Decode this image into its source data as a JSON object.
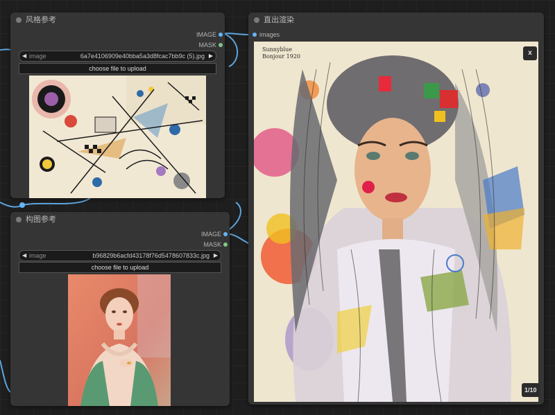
{
  "colors": {
    "canvas": "#1e1e1e",
    "node_bg": "#353535",
    "wire_image": "#64b5f6",
    "mask_socket": "#81c784"
  },
  "node_style": {
    "title": "风格参考",
    "outputs": [
      "IMAGE",
      "MASK"
    ],
    "widget_label": "image",
    "widget_value": "6a7e4106909e40bba5a3d8fcac7bb9c (5).jpg",
    "upload_label": "choose file to upload"
  },
  "node_composition": {
    "title": "构图参考",
    "outputs": [
      "IMAGE",
      "MASK"
    ],
    "widget_label": "image",
    "widget_value": "b96829b6acfd43178f76d5478607833c.jpg",
    "upload_label": "choose file to upload"
  },
  "node_render": {
    "title": "直出渲染",
    "input": "images",
    "close_label": "x",
    "counter": "1/10",
    "artwork_text": [
      "Sunnyblue",
      "Bonjour 1920"
    ]
  }
}
